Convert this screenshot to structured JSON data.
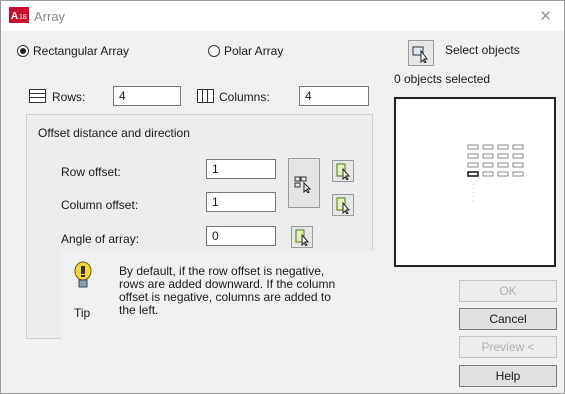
{
  "window": {
    "title": "Array"
  },
  "array_type": {
    "rectangular_label": "Rectangular Array",
    "polar_label": "Polar Array",
    "selected": "rectangular"
  },
  "rows": {
    "label": "Rows:",
    "value": "4"
  },
  "columns": {
    "label": "Columns:",
    "value": "4"
  },
  "offset_group": {
    "title": "Offset distance and direction"
  },
  "row_offset": {
    "label": "Row offset:",
    "value": "1"
  },
  "column_offset": {
    "label": "Column offset:",
    "value": "1"
  },
  "angle": {
    "label": "Angle of array:",
    "value": "0"
  },
  "tip": {
    "label": "Tip",
    "text": "By default, if the row offset is negative, rows are added downward. If the column offset is negative, columns are added to the left."
  },
  "selection": {
    "button_label": "Select objects",
    "status": "0 objects selected"
  },
  "buttons": {
    "ok": "OK",
    "cancel": "Cancel",
    "preview": "Preview <",
    "help": "Help"
  },
  "icons": [
    "autocad-app-icon",
    "close-icon",
    "rows-icon",
    "columns-icon",
    "pick-both-offsets-icon",
    "pick-row-offset-icon",
    "pick-column-offset-icon",
    "pick-angle-icon",
    "lightbulb-icon",
    "select-objects-icon"
  ]
}
